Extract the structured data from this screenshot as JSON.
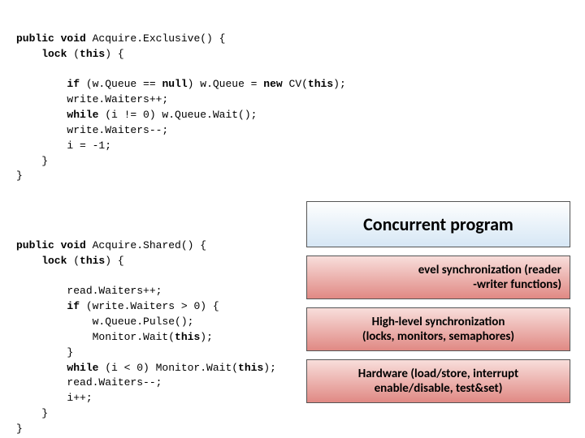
{
  "code": {
    "top": {
      "l1_a": "public void ",
      "l1_b": "Acquire.Exclusive() {",
      "l2_a": "    lock ",
      "l2_b": "(",
      "l2_c": "this",
      "l2_d": ") {",
      "l3": " ",
      "l4_a": "        if ",
      "l4_b": "(w.Queue == ",
      "l4_c": "null",
      "l4_d": ") w.Queue = ",
      "l4_e": "new ",
      "l4_f": "CV(",
      "l4_g": "this",
      "l4_h": ");",
      "l5": "        write.Waiters++;",
      "l6_a": "        while ",
      "l6_b": "(i != 0) w.Queue.Wait();",
      "l7": "        write.Waiters--;",
      "l8": "        i = -1;",
      "l9": "    }",
      "l10": "}"
    },
    "bottom": {
      "l1_a": "public void ",
      "l1_b": "Acquire.Shared() {",
      "l2_a": "    lock ",
      "l2_b": "(",
      "l2_c": "this",
      "l2_d": ") {",
      "l3": " ",
      "l4": "        read.Waiters++;",
      "l5_a": "        if ",
      "l5_b": "(write.Waiters > 0) {",
      "l6": "            w.Queue.Pulse();",
      "l7_a": "            Monitor.Wait(",
      "l7_b": "this",
      "l7_c": ");",
      "l8": "        }",
      "l9_a": "        while ",
      "l9_b": "(i < 0) Monitor.Wait(",
      "l9_c": "this",
      "l9_d": ");",
      "l10": "        read.Waiters--;",
      "l11": "        i++;",
      "l12": "    }",
      "l13": "}"
    }
  },
  "layers": {
    "title": "Concurrent program",
    "partial_a": "evel synchronization   (reader",
    "partial_b": "-writer functions)",
    "high_a": "High-level synchronization",
    "high_b": "(locks, monitors, semaphores)",
    "hw_a": "Hardware (load/store, interrupt",
    "hw_b": "enable/disable, test&set)"
  }
}
